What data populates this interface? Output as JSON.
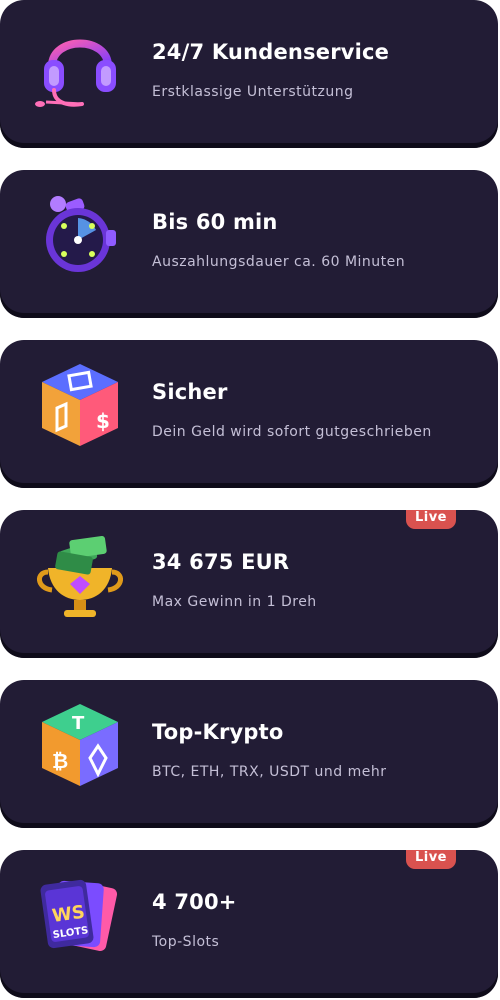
{
  "features": [
    {
      "icon": "headset-icon",
      "title": "24/7 Kundenservice",
      "subtitle": "Erstklassige Unterstützung",
      "badge": ""
    },
    {
      "icon": "stopwatch-icon",
      "title": "Bis 60 min",
      "subtitle": "Auszahlungsdauer ca. 60 Minuten",
      "badge": ""
    },
    {
      "icon": "shield-dice-icon",
      "title": "Sicher",
      "subtitle": "Dein Geld wird sofort gutgeschrieben",
      "badge": ""
    },
    {
      "icon": "trophy-money-icon",
      "title": "34 675 EUR",
      "subtitle": "Max Gewinn in 1 Dreh",
      "badge": "Live"
    },
    {
      "icon": "crypto-dice-icon",
      "title": "Top-Krypto",
      "subtitle": "BTC, ETH, TRX, USDT und mehr",
      "badge": ""
    },
    {
      "icon": "slots-cards-icon",
      "title": "4 700+",
      "subtitle": "Top-Slots",
      "badge": "Live"
    }
  ],
  "colors": {
    "card_bg": "#221c35",
    "title": "#ffffff",
    "subtitle": "#c4bfd6",
    "badge_bg": "#d9524f"
  }
}
